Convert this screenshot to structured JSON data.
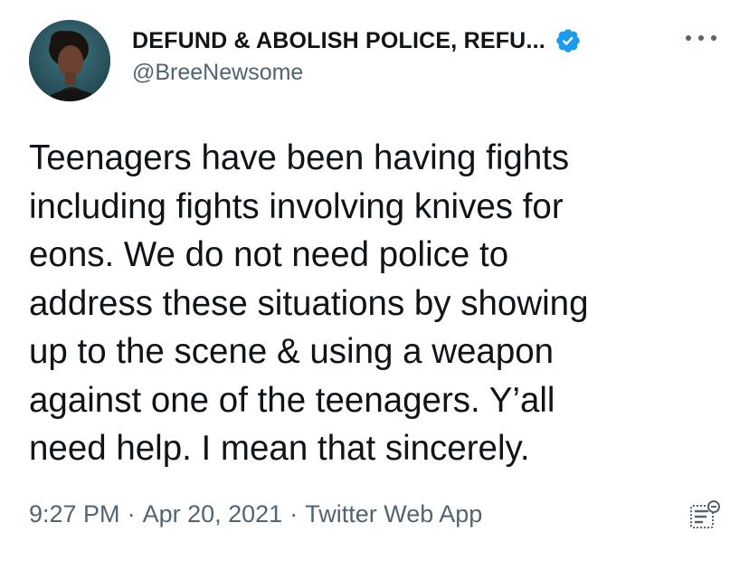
{
  "tweet": {
    "author": {
      "display_name": "DEFUND & ABOLISH POLICE, REFU...",
      "handle": "@BreeNewsome",
      "verified": true,
      "avatar_icon": "profile-photo"
    },
    "text": "Teenagers have been having fights\nincluding fights involving knives for\neons. We do not need police to\naddress these situations  by showing\nup to the scene & using a weapon\nagainst one of the teenagers. Y’all\nneed help. I mean that sincerely.",
    "time": "9:27 PM",
    "date": "Apr 20, 2021",
    "source": "Twitter Web App",
    "separator": "·",
    "more_icon": "more-options-icon",
    "analytics_icon": "analytics-icon"
  },
  "colors": {
    "text_primary": "#0f1419",
    "text_secondary": "#536471",
    "verified_badge": "#1d9bf0",
    "background": "#ffffff"
  }
}
